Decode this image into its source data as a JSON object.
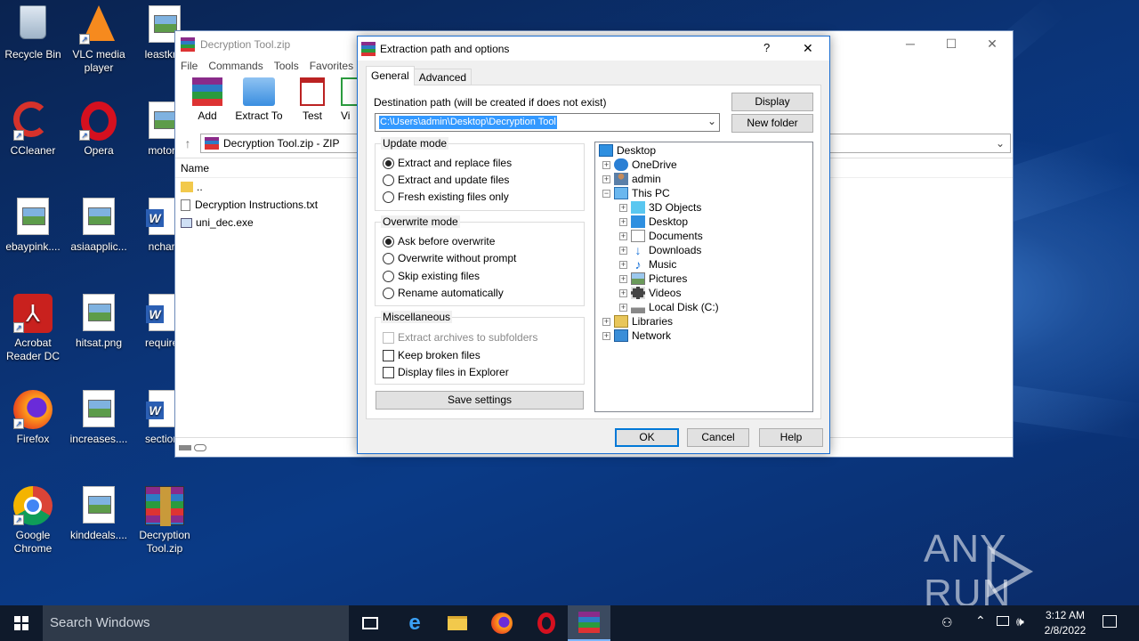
{
  "desktop": {
    "icons": [
      {
        "label": "Recycle Bin",
        "icon": "recycle-bin-icon"
      },
      {
        "label": "VLC media player",
        "icon": "vlc-icon"
      },
      {
        "label": "leastkno",
        "icon": "image-file-icon"
      },
      {
        "label": "CCleaner",
        "icon": "ccleaner-icon"
      },
      {
        "label": "Opera",
        "icon": "opera-icon"
      },
      {
        "label": "motorp",
        "icon": "image-file-icon"
      },
      {
        "label": "ebaypink....",
        "icon": "image-file-icon"
      },
      {
        "label": "asiaapplic...",
        "icon": "image-file-icon"
      },
      {
        "label": "ncharg",
        "icon": "word-file-icon"
      },
      {
        "label": "Acrobat Reader DC",
        "icon": "acrobat-icon"
      },
      {
        "label": "hitsat.png",
        "icon": "image-file-icon"
      },
      {
        "label": "required",
        "icon": "word-file-icon"
      },
      {
        "label": "Firefox",
        "icon": "firefox-icon"
      },
      {
        "label": "increases....",
        "icon": "image-file-icon"
      },
      {
        "label": "sections",
        "icon": "word-file-icon"
      },
      {
        "label": "Google Chrome",
        "icon": "chrome-icon"
      },
      {
        "label": "kinddeals....",
        "icon": "image-file-icon"
      },
      {
        "label": "Decryption Tool.zip",
        "icon": "winrar-archive-icon"
      }
    ]
  },
  "winrar": {
    "title": "Decryption Tool.zip",
    "menu": [
      "File",
      "Commands",
      "Tools",
      "Favorites"
    ],
    "toolbar": [
      "Add",
      "Extract To",
      "Test",
      "Vi"
    ],
    "address": "Decryption Tool.zip - ZIP",
    "column_name": "Name",
    "files": [
      {
        "name": "..",
        "icon": "folder-icon"
      },
      {
        "name": "Decryption Instructions.txt",
        "icon": "text-file-icon"
      },
      {
        "name": "uni_dec.exe",
        "icon": "exe-file-icon"
      }
    ]
  },
  "dialog": {
    "title": "Extraction path and options",
    "help_glyph": "?",
    "close_glyph": "✕",
    "tabs": [
      "General",
      "Advanced"
    ],
    "active_tab": "General",
    "dest_label": "Destination path (will be created if does not exist)",
    "dest_value": "C:\\Users\\admin\\Desktop\\Decryption Tool",
    "display_button": "Display",
    "new_folder_button": "New folder",
    "update_mode": {
      "title": "Update mode",
      "options": [
        "Extract and replace files",
        "Extract and update files",
        "Fresh existing files only"
      ],
      "selected": 0
    },
    "overwrite_mode": {
      "title": "Overwrite mode",
      "options": [
        "Ask before overwrite",
        "Overwrite without prompt",
        "Skip existing files",
        "Rename automatically"
      ],
      "selected": 0
    },
    "misc": {
      "title": "Miscellaneous",
      "options": [
        "Extract archives to subfolders",
        "Keep broken files",
        "Display files in Explorer"
      ]
    },
    "save_settings": "Save settings",
    "tree": [
      {
        "label": "Desktop",
        "icon": "desktop-icon"
      },
      {
        "label": "OneDrive",
        "icon": "onedrive-icon"
      },
      {
        "label": "admin",
        "icon": "user-icon"
      },
      {
        "label": "This PC",
        "icon": "computer-icon"
      },
      {
        "label": "3D Objects",
        "icon": "3d-objects-icon"
      },
      {
        "label": "Desktop",
        "icon": "desktop-icon"
      },
      {
        "label": "Documents",
        "icon": "documents-icon"
      },
      {
        "label": "Downloads",
        "icon": "downloads-icon"
      },
      {
        "label": "Music",
        "icon": "music-icon"
      },
      {
        "label": "Pictures",
        "icon": "pictures-icon"
      },
      {
        "label": "Videos",
        "icon": "videos-icon"
      },
      {
        "label": "Local Disk (C:)",
        "icon": "disk-icon"
      },
      {
        "label": "Libraries",
        "icon": "libraries-icon"
      },
      {
        "label": "Network",
        "icon": "network-icon"
      }
    ],
    "ok": "OK",
    "cancel": "Cancel",
    "help": "Help"
  },
  "taskbar": {
    "search_placeholder": "Search Windows",
    "time": "3:12 AM",
    "date": "2/8/2022"
  },
  "watermark": "ANY RUN",
  "colors": {
    "accent": "#0078d7",
    "selection": "#3399ff",
    "taskbar": "#0f1a2b"
  }
}
